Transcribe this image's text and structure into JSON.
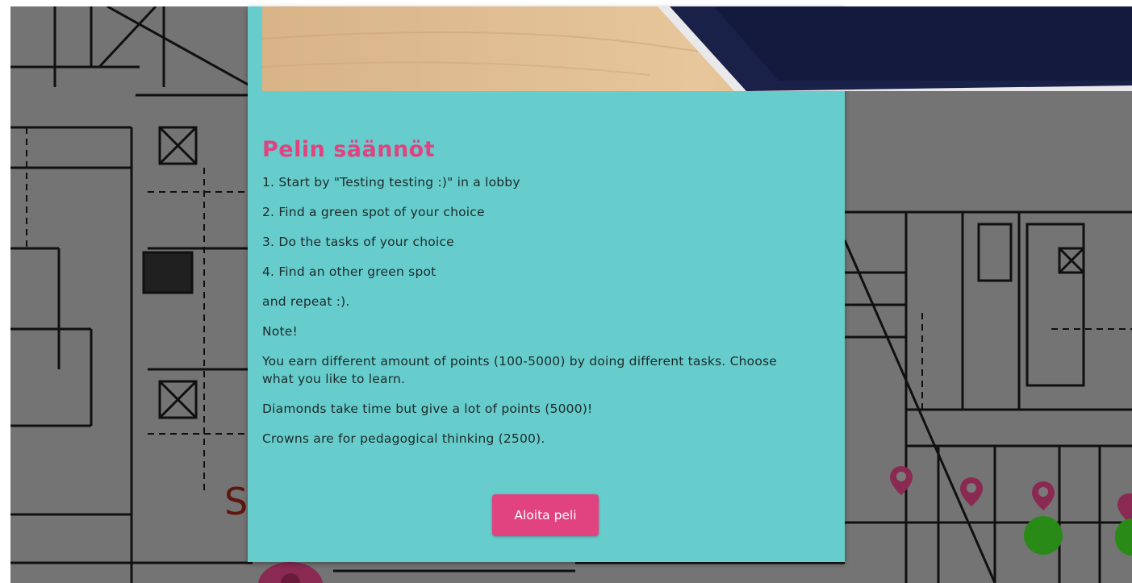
{
  "modal": {
    "title": "Pelin säännöt",
    "rules": [
      "1. Start by \"Testing testing :)\" in a lobby",
      "2. Find a green spot of your choice",
      "3. Do the tasks of your choice",
      "4. Find an other green spot",
      "and repeat :).",
      "Note!",
      "You earn different amount of points (100-5000) by doing different tasks. Choose what you like to learn.",
      "Diamonds take time but give a lot of points (5000)!",
      "Crowns are for pedagogical thinking (2500)."
    ],
    "start_button_label": "Aloita peli"
  },
  "map": {
    "pins_icon": "map-pin-icon",
    "spots_icon": "green-spot-icon",
    "label_fragment": "S"
  },
  "colors": {
    "modal_background": "#66cccc",
    "accent": "#e0437f",
    "pin": "#b03a66",
    "green_spot": "#3aa020"
  }
}
